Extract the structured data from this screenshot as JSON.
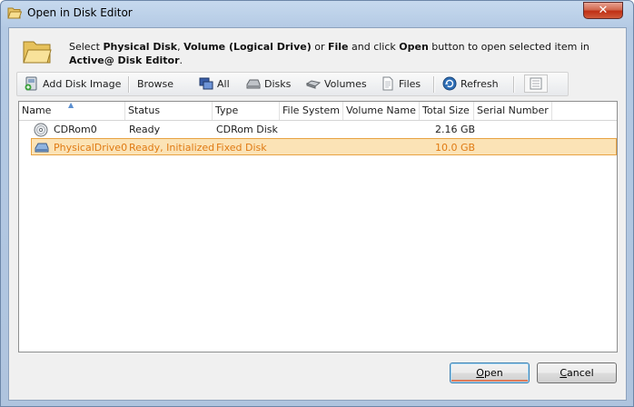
{
  "window": {
    "title": "Open in Disk Editor",
    "close_label": "✕"
  },
  "header": {
    "desc_part1": "Select ",
    "desc_bold1": "Physical Disk",
    "desc_part2": ", ",
    "desc_bold2": "Volume (Logical Drive)",
    "desc_part3": " or ",
    "desc_bold3": "File",
    "desc_part4": " and click ",
    "desc_bold4": "Open",
    "desc_part5": " button to open selected item in ",
    "desc_bold5": "Active@ Disk Editor",
    "desc_part6": "."
  },
  "toolbar": {
    "add_disk_image": "Add Disk Image",
    "browse_for": "Browse for:",
    "all": "All",
    "disks": "Disks",
    "volumes": "Volumes",
    "files": "Files",
    "refresh": "Refresh"
  },
  "table": {
    "columns": [
      "Name",
      "Status",
      "Type",
      "File System",
      "Volume Name",
      "Total Size",
      "Serial Number"
    ],
    "rows": [
      {
        "icon": "cdrom-icon",
        "name": "CDRom0",
        "status": "Ready",
        "type": "CDRom Disk",
        "file_system": "",
        "volume_name": "",
        "total_size": "2.16 GB",
        "serial": ""
      },
      {
        "icon": "hard-disk-icon",
        "name": "PhysicalDrive0",
        "status": "Ready, Initialized",
        "type": "Fixed Disk",
        "file_system": "",
        "volume_name": "",
        "total_size": "10.0 GB",
        "serial": ""
      }
    ]
  },
  "buttons": {
    "open_first": "O",
    "open_rest": "pen",
    "cancel_first": "C",
    "cancel_rest": "ancel"
  },
  "colors": {
    "selection_fill": "#fbe3b6",
    "selection_border": "#e8a343",
    "selection_text": "#e07b14",
    "close_button": "#c7452a"
  }
}
